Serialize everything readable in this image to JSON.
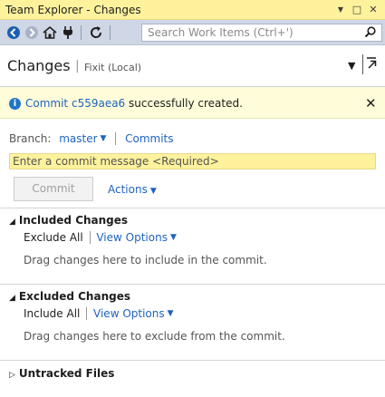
{
  "window": {
    "title": "Team Explorer - Changes",
    "pin_glyph": "▼",
    "maximize_glyph": "□",
    "close_glyph": "✕"
  },
  "toolbar": {
    "back_icon": "back-arrow-icon",
    "forward_icon": "forward-arrow-icon",
    "home_icon": "home-icon",
    "connect_icon": "plug-icon",
    "refresh_icon": "refresh-icon",
    "search_placeholder": "Search Work Items (Ctrl+')"
  },
  "header": {
    "title": "Changes",
    "separator": "|",
    "subtitle": "Fixit (Local)"
  },
  "infobar": {
    "prefix": "Commit",
    "commit_id": "c559aea6",
    "suffix": "successfully created.",
    "close_glyph": "✕"
  },
  "branch": {
    "label": "Branch:",
    "name": "master",
    "commits_link": "Commits"
  },
  "commit": {
    "message_placeholder": "Enter a commit message <Required>",
    "button_label": "Commit",
    "actions_label": "Actions"
  },
  "included": {
    "title": "Included Changes",
    "action": "Exclude All",
    "view_options": "View Options",
    "hint": "Drag changes here to include in the commit."
  },
  "excluded": {
    "title": "Excluded Changes",
    "action": "Include All",
    "view_options": "View Options",
    "hint": "Drag changes here to exclude from the commit."
  },
  "untracked": {
    "title": "Untracked Files"
  },
  "colors": {
    "title_bar": "#fff29d",
    "toolbar": "#cfd6e5",
    "link": "#1e64c0",
    "infobar": "#fffcd9",
    "info_icon": "#1f75c8"
  }
}
